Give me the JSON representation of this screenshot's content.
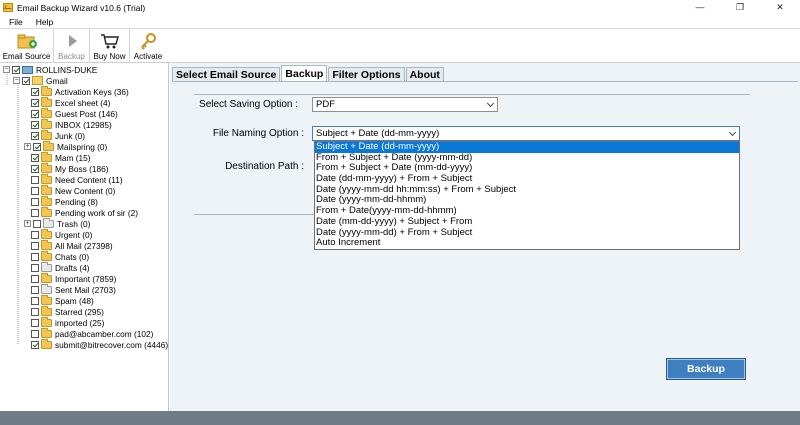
{
  "window": {
    "title": "Email Backup Wizard v10.6 (Trial)",
    "controls": [
      "—",
      "❐",
      "✕"
    ]
  },
  "menu": [
    "File",
    "Help"
  ],
  "toolbar": [
    {
      "label": "Email Source",
      "icon": "folder-add-icon",
      "enabled": true
    },
    {
      "label": "Backup",
      "icon": "play-icon",
      "enabled": false
    },
    {
      "label": "Buy Now",
      "icon": "cart-icon",
      "enabled": true
    },
    {
      "label": "Activate",
      "icon": "key-icon",
      "enabled": true
    }
  ],
  "tree": {
    "root": "ROLLINS-DUKE",
    "account": "Gmail",
    "folders": [
      {
        "label": "Activation Keys (36)",
        "checked": true,
        "expander": false
      },
      {
        "label": "Excel sheet (4)",
        "checked": true,
        "expander": false
      },
      {
        "label": "Guest Post (146)",
        "checked": true,
        "expander": false
      },
      {
        "label": "INBOX (12985)",
        "checked": true,
        "expander": false
      },
      {
        "label": "Junk (0)",
        "checked": true,
        "expander": false
      },
      {
        "label": "Mailspring (0)",
        "checked": true,
        "expander": true
      },
      {
        "label": "Mam (15)",
        "checked": true,
        "expander": false
      },
      {
        "label": "My Boss (186)",
        "checked": true,
        "expander": false
      },
      {
        "label": "Need Content (11)",
        "checked": false,
        "expander": false
      },
      {
        "label": "New Content (0)",
        "checked": false,
        "expander": false
      },
      {
        "label": "Pending (8)",
        "checked": false,
        "expander": false
      },
      {
        "label": "Pending work of sir (2)",
        "checked": false,
        "expander": false
      },
      {
        "label": "Trash (0)",
        "checked": false,
        "expander": true,
        "special": true
      },
      {
        "label": "Urgent (0)",
        "checked": false,
        "expander": false
      },
      {
        "label": "All Mail (27398)",
        "checked": false,
        "expander": false
      },
      {
        "label": "Chats (0)",
        "checked": false,
        "expander": false
      },
      {
        "label": "Drafts (4)",
        "checked": false,
        "expander": false,
        "special": true
      },
      {
        "label": "Important (7859)",
        "checked": false,
        "expander": false
      },
      {
        "label": "Sent Mail (2703)",
        "checked": false,
        "expander": false,
        "special": true
      },
      {
        "label": "Spam (48)",
        "checked": false,
        "expander": false
      },
      {
        "label": "Starred (295)",
        "checked": false,
        "expander": false
      },
      {
        "label": "imported (25)",
        "checked": false,
        "expander": false
      },
      {
        "label": "pad@abcamber.com (102)",
        "checked": false,
        "expander": false
      },
      {
        "label": "submit@bitrecover.com (4446)",
        "checked": true,
        "expander": false
      }
    ]
  },
  "tabs": [
    "Select Email Source",
    "Backup",
    "Filter Options",
    "About"
  ],
  "active_tab": "Backup",
  "form": {
    "saving_label": "Select Saving Option :",
    "saving_value": "PDF",
    "naming_label": "File Naming Option :",
    "naming_value": "Subject + Date (dd-mm-yyyy)",
    "destination_label": "Destination Path :"
  },
  "naming_options": [
    "Subject + Date (dd-mm-yyyy)",
    "From + Subject + Date (yyyy-mm-dd)",
    "From + Subject + Date (mm-dd-yyyy)",
    "Date (dd-mm-yyyy) + From + Subject",
    "Date (yyyy-mm-dd hh:mm:ss) + From + Subject",
    "Date (yyyy-mm-dd-hhmm)",
    "From + Date(yyyy-mm-dd-hhmm)",
    "Date (mm-dd-yyyy) + Subject + From",
    "Date (yyyy-mm-dd) + From + Subject",
    "Auto Increment"
  ],
  "selected_option_index": 0,
  "backup_button": "Backup"
}
